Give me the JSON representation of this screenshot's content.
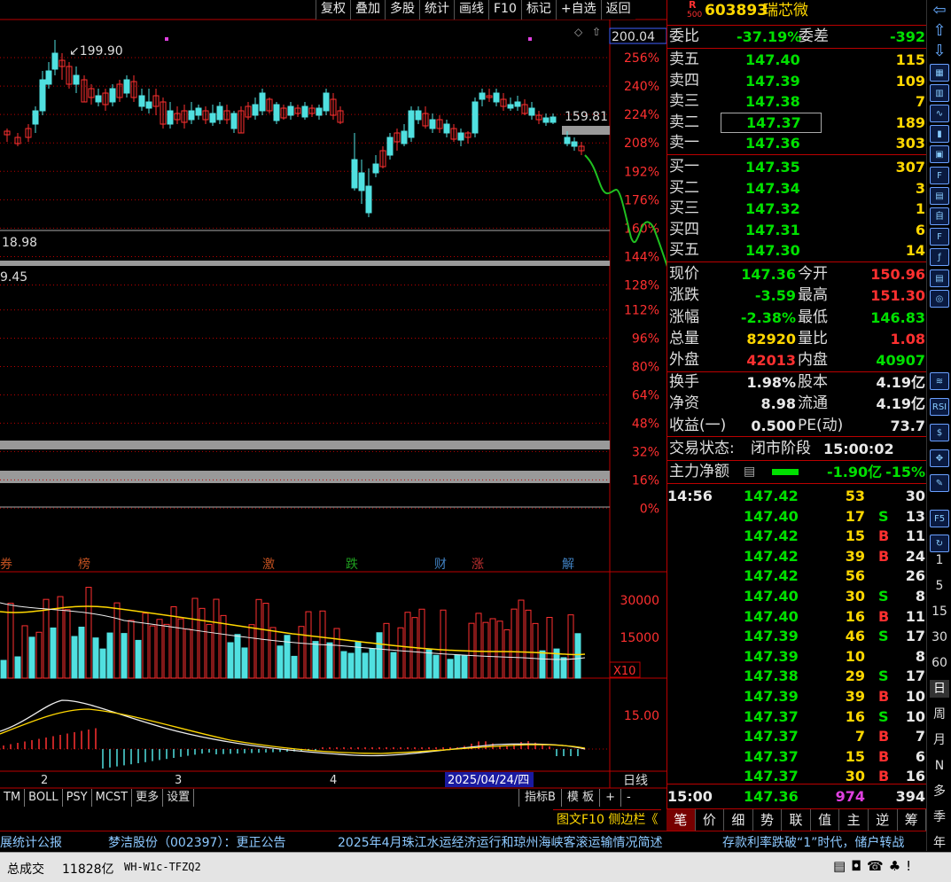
{
  "toolbar": {
    "items": [
      "复权",
      "叠加",
      "多股",
      "统计",
      "画线",
      "F10",
      "标记",
      "+自选",
      "返回"
    ]
  },
  "stock": {
    "badge_top": "R",
    "badge_bot": "500",
    "code": "603893",
    "name": "瑞芯微"
  },
  "weibi": {
    "label1": "委比",
    "val1": "-37.19%",
    "label2": "委差",
    "val2": "-392"
  },
  "sell": [
    {
      "label": "卖五",
      "price": "147.40",
      "vol": "115"
    },
    {
      "label": "卖四",
      "price": "147.39",
      "vol": "109"
    },
    {
      "label": "卖三",
      "price": "147.38",
      "vol": "7"
    },
    {
      "label": "卖二",
      "price": "147.37",
      "vol": "189"
    },
    {
      "label": "卖一",
      "price": "147.36",
      "vol": "303"
    }
  ],
  "buy": [
    {
      "label": "买一",
      "price": "147.35",
      "vol": "307"
    },
    {
      "label": "买二",
      "price": "147.34",
      "vol": "3"
    },
    {
      "label": "买三",
      "price": "147.32",
      "vol": "1"
    },
    {
      "label": "买四",
      "price": "147.31",
      "vol": "6"
    },
    {
      "label": "买五",
      "price": "147.30",
      "vol": "14"
    }
  ],
  "quote": [
    {
      "l1": "现价",
      "v1": "147.36",
      "c1": "g",
      "l2": "今开",
      "v2": "150.96",
      "c2": "r"
    },
    {
      "l1": "涨跌",
      "v1": "-3.59",
      "c1": "g",
      "l2": "最高",
      "v2": "151.30",
      "c2": "r"
    },
    {
      "l1": "涨幅",
      "v1": "-2.38%",
      "c1": "g",
      "l2": "最低",
      "v2": "146.83",
      "c2": "g"
    },
    {
      "l1": "总量",
      "v1": "82920",
      "c1": "y",
      "l2": "量比",
      "v2": "1.08",
      "c2": "r"
    },
    {
      "l1": "外盘",
      "v1": "42013",
      "c1": "r",
      "l2": "内盘",
      "v2": "40907",
      "c2": "g"
    }
  ],
  "stats": [
    {
      "l1": "换手",
      "v1": "1.98%",
      "l2": "股本",
      "v2": "4.19亿"
    },
    {
      "l1": "净资",
      "v1": "8.98",
      "l2": "流通",
      "v2": "4.19亿"
    },
    {
      "l1": "收益(一)",
      "v1": "0.500",
      "l2": "PE(动)",
      "v2": "73.7"
    }
  ],
  "status": {
    "label": "交易状态:",
    "value": "闭市阶段",
    "time": "15:00:02"
  },
  "mainflow": {
    "label": "主力净额",
    "value": "-1.90亿",
    "pct": "-15%"
  },
  "ticks": [
    {
      "t": "14:56",
      "p": "147.42",
      "v": "53",
      "s": "",
      "n": "30"
    },
    {
      "t": "",
      "p": "147.40",
      "v": "17",
      "s": "S",
      "n": "13"
    },
    {
      "t": "",
      "p": "147.42",
      "v": "15",
      "s": "B",
      "n": "11"
    },
    {
      "t": "",
      "p": "147.42",
      "v": "39",
      "s": "B",
      "n": "24"
    },
    {
      "t": "",
      "p": "147.42",
      "v": "56",
      "s": "",
      "n": "26"
    },
    {
      "t": "",
      "p": "147.40",
      "v": "30",
      "s": "S",
      "n": "8"
    },
    {
      "t": "",
      "p": "147.40",
      "v": "16",
      "s": "B",
      "n": "11"
    },
    {
      "t": "",
      "p": "147.39",
      "v": "46",
      "s": "S",
      "n": "17"
    },
    {
      "t": "",
      "p": "147.39",
      "v": "10",
      "s": "",
      "n": "8"
    },
    {
      "t": "",
      "p": "147.38",
      "v": "29",
      "s": "S",
      "n": "17"
    },
    {
      "t": "",
      "p": "147.39",
      "v": "39",
      "s": "B",
      "n": "10"
    },
    {
      "t": "",
      "p": "147.37",
      "v": "16",
      "s": "S",
      "n": "10"
    },
    {
      "t": "",
      "p": "147.37",
      "v": "7",
      "s": "B",
      "n": "7"
    },
    {
      "t": "",
      "p": "147.37",
      "v": "15",
      "s": "B",
      "n": "6"
    },
    {
      "t": "",
      "p": "147.37",
      "v": "30",
      "s": "B",
      "n": "16"
    },
    {
      "t": "15:00",
      "p": "147.36",
      "v": "974",
      "s": "",
      "n": "394"
    }
  ],
  "right_tabs": [
    "笔",
    "价",
    "细",
    "势",
    "联",
    "值",
    "主",
    "逆",
    "筹"
  ],
  "chart_labels": {
    "high": "199.90",
    "mid": "159.81",
    "low": "18.98",
    "low2": "9.45",
    "box": "200.04",
    "vol_x": "X10",
    "macd_val": "15.00",
    "vol1": "30000",
    "vol2": "15000",
    "date": "2025/04/24/四",
    "period": "日线",
    "month2": "2",
    "month3": "3",
    "month4": "4"
  },
  "pct_axis": [
    "256%",
    "240%",
    "224%",
    "208%",
    "192%",
    "176%",
    "160%",
    "144%",
    "128%",
    "112%",
    "96%",
    "80%",
    "64%",
    "48%",
    "32%",
    "16%",
    "0%"
  ],
  "events": [
    {
      "t": "榜",
      "c": "#c05020"
    },
    {
      "t": "激",
      "c": "#c05020"
    },
    {
      "t": "跌",
      "c": "#20a020"
    },
    {
      "t": "财",
      "c": "#4080c0"
    },
    {
      "t": "涨",
      "c": "#c03030"
    },
    {
      "t": "解",
      "c": "#4080c0"
    }
  ],
  "ind_tabs": [
    "TM",
    "BOLL",
    "PSY",
    "MCST",
    "更多",
    "设置"
  ],
  "ind_right": [
    "指标B",
    "模 板",
    "+",
    "-"
  ],
  "f10_tab": "图文F10 侧边栏《",
  "news": [
    "展统计公报",
    "梦洁股份（002397）：更正公告",
    "2025年4月珠江水运经济运行和琼州海峡客滚运输情况简述",
    "存款利率跌破“1”时代，储户转战"
  ],
  "bottom": {
    "label": "总成交",
    "value": "11828亿",
    "sys": "WH-W1c-TFZQ2"
  },
  "side": [
    "1",
    "5",
    "15",
    "30",
    "60",
    "日",
    "周",
    "月",
    "N",
    "多",
    "季",
    "年"
  ]
}
